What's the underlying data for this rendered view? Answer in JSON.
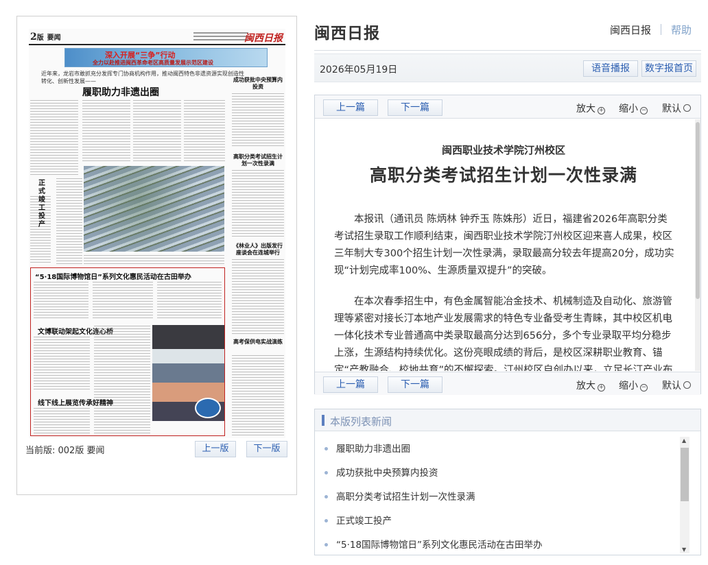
{
  "site": {
    "title": "闽西日报",
    "links": [
      "闽西日报",
      "帮助"
    ]
  },
  "datebar": {
    "date": "2026年05月19日",
    "buttons": [
      "语音播报",
      "数字报首页"
    ]
  },
  "newspaper_page": {
    "page_num": "2",
    "page_unit": "版",
    "section": "要闻",
    "logo": "闽西日报",
    "banner_line1": "深入开展“三争”行动",
    "banner_line2": "全力以赴推进闽西革命老区高质量发展示范区建设",
    "lead_small": "近年来，龙岩市敢抓充分发挥专门协商机构作用，推动闽西特色非遗资源实现创造性转化、创新性发展——",
    "lead_title": "履职助力非遗出圈",
    "side_title_1": "成功获批中央预算内投资",
    "side_title_2": "高职分类考试招生计划一次性录满",
    "side_title_3": "《林业人》出版发行座谈会在连城举行",
    "side_title_4": "高考保供电实战演练",
    "vertical_title": "正式竣工投产",
    "red_box_title": "“5·18国际博物馆日”系列文化惠民活动在古田举办",
    "red_sub_1": "文博联动架起文化连心桥",
    "red_sub_2": "线下线上展览传承好精神",
    "current_page_label": "当前版: 002版 要闻",
    "prev_page": "上一版",
    "next_page": "下一版"
  },
  "article": {
    "nav": {
      "prev": "上一篇",
      "next": "下一篇",
      "zoom_in": "放大",
      "zoom_out": "缩小",
      "default": "默认"
    },
    "subhead": "闽西职业技术学院汀州校区",
    "headline": "高职分类考试招生计划一次性录满",
    "paragraphs": [
      "本报讯（通讯员 陈炳林 钟乔玉 陈姝彤）近日，福建省2026年高职分类考试招生录取工作顺利结束，闽西职业技术学院汀州校区迎来喜人成果，校区三年制大专300个招生计划一次性录满，录取最高分较去年提高20分，成功实现“计划完成率100%、生源质量双提升”的突破。",
      "在本次春季招生中，有色金属智能冶金技术、机械制造及自动化、旅游管理等紧密对接长汀本地产业发展需求的特色专业备受考生青睐，其中校区机电一体化技术专业普通高中类录取最高分达到656分，多个专业录取平均分稳步上涨，生源结构持续优化。这份亮眼成绩的背后，是校区深耕职业教育、锚定“产教融合、校地共育”的不懈探索。汀州校区自创办以来，立足长汀产业布局，紧跟区"
    ]
  },
  "news_list": {
    "title": "本版列表新闻",
    "items": [
      "履职助力非遗出圈",
      "成功获批中央预算内投资",
      "高职分类考试招生计划一次性录满",
      "正式竣工投产",
      "“5·18国际博物馆日”系列文化惠民活动在古田举办"
    ]
  }
}
